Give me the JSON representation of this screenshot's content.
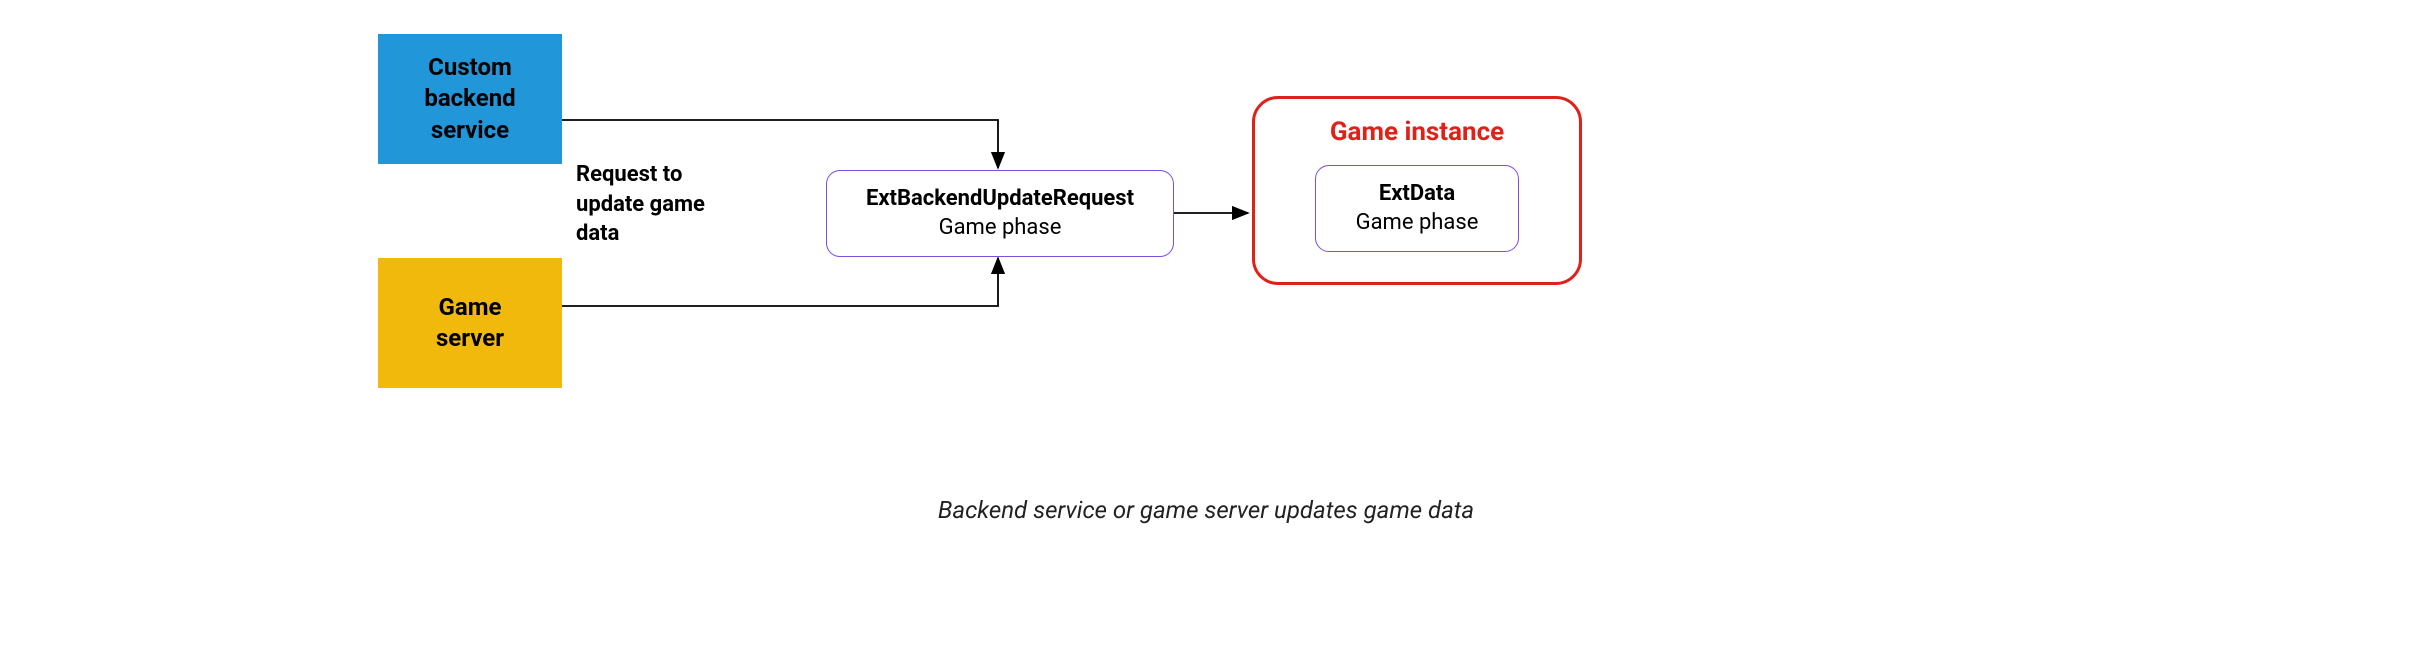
{
  "nodes": {
    "custom_backend": "Custom\nbackend\nservice",
    "game_server": "Game\nserver",
    "ext_request": {
      "title": "ExtBackendUpdateRequest",
      "subtitle": "Game phase"
    },
    "game_instance": {
      "title": "Game instance",
      "ext_data": {
        "title": "ExtData",
        "subtitle": "Game phase"
      }
    }
  },
  "edge_label": "Request to\nupdate game\ndata",
  "caption": "Backend service or game server updates game data"
}
